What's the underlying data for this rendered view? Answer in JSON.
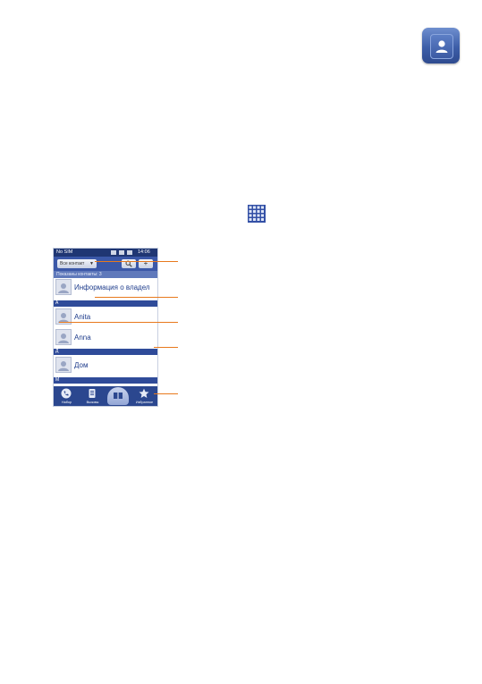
{
  "icons": {
    "app": "contacts-app-icon",
    "launcher": "app-grid-icon"
  },
  "phone": {
    "status": {
      "carrier": "No SIM",
      "time": "14:06"
    },
    "toolbar": {
      "filter_label": "Все контакт",
      "search_icon": "search-icon",
      "add_label": "+"
    },
    "contact_count": "Показаны контакты: 3",
    "owner_row": {
      "name": "Информация о владел"
    },
    "sections": [
      {
        "letter": "A",
        "contacts": [
          "Anita",
          "Anna"
        ]
      },
      {
        "letter": "Д",
        "contacts": [
          "Дом"
        ]
      },
      {
        "letter": "M",
        "contacts": []
      }
    ],
    "bottom_nav": [
      {
        "label": "Набор",
        "icon": "dialer-icon"
      },
      {
        "label": "Вызовы",
        "icon": "call-log-icon"
      },
      {
        "label": "",
        "icon": "groups-icon"
      },
      {
        "label": "Избранное",
        "icon": "star-icon"
      }
    ]
  },
  "colors": {
    "callout": "#e8791d",
    "accent": "#2f4b99"
  }
}
